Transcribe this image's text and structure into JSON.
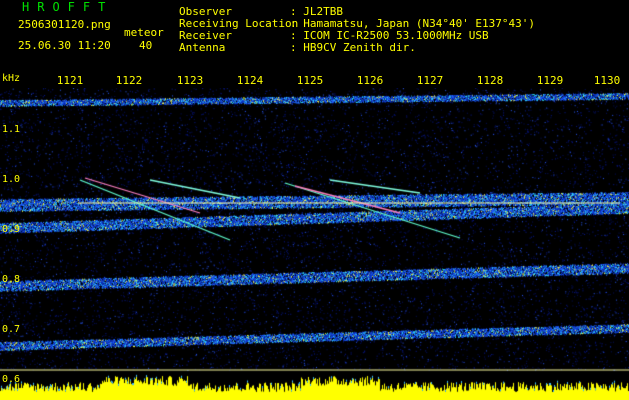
{
  "header": {
    "brand": "HROFFT",
    "filename": "2506301120.png",
    "datetime": "25.06.30 11:20",
    "meteor_label": "meteor",
    "meteor_count": "40",
    "rows": [
      {
        "label": "Observer",
        "value": ": JL2TBB"
      },
      {
        "label": "Receiving Location",
        "value": ": Hamamatsu, Japan (N34°40' E137°43')"
      },
      {
        "label": "Receiver",
        "value": ": ICOM IC-R2500 53.1000MHz USB"
      },
      {
        "label": "Antenna",
        "value": ": HB9CV Zenith dir."
      }
    ]
  },
  "axis": {
    "unit": "kHz",
    "time_ticks": [
      "1121",
      "1122",
      "1123",
      "1124",
      "1125",
      "1126",
      "1127",
      "1128",
      "1129",
      "1130"
    ],
    "freq_ticks": [
      "1.1",
      "1.0",
      "0.9",
      "0.8",
      "0.7",
      "0.6"
    ]
  },
  "colors": {
    "text": "#ffff00",
    "brand": "#00e000",
    "background": "#000000",
    "marker_line": "#ffffa0"
  }
}
